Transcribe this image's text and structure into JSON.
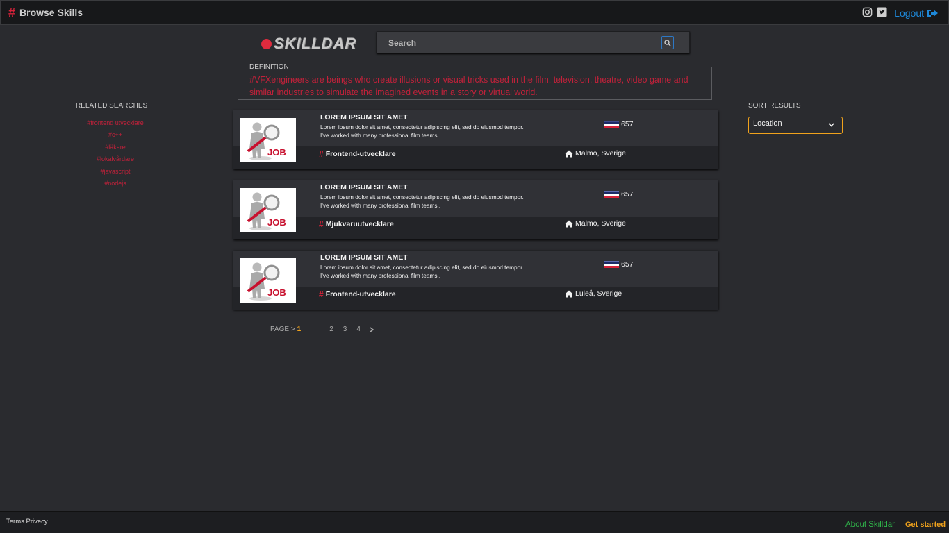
{
  "header": {
    "title": "Browse Skills",
    "logout_label": "Logout"
  },
  "logo": {
    "text": "SKILLDAR"
  },
  "search": {
    "placeholder": "Search"
  },
  "definition": {
    "legend": "DEFINITION",
    "text": "#VFXengineers are beings who create illusions or visual tricks used in the film, television, theatre, video game and similar industries to simulate the imagined events in a story or virtual world."
  },
  "related": {
    "title": "RELATED SEARCHES",
    "items": [
      "#frontend utvecklare",
      "#c++",
      "#läkare",
      "#lokalvårdare",
      "#javascript",
      "#nodejs"
    ]
  },
  "sort": {
    "title": "SORT RESULTS",
    "selected": "Location"
  },
  "cards": [
    {
      "title": "LOREM IPSUM SIT AMET",
      "desc_line1": "Lorem ipsum dolor sit amet, consectetur adipiscing elit, sed do eiusmod tempor.",
      "desc_line2": "I've worked with many professional film teams..",
      "score": "657",
      "skill": "Frontend-utvecklare",
      "location": "Malmö, Sverige",
      "thumb_text": "JOB"
    },
    {
      "title": "LOREM IPSUM SIT AMET",
      "desc_line1": "Lorem ipsum dolor sit amet, consectetur adipiscing elit, sed do eiusmod tempor.",
      "desc_line2": "I've worked with many professional film teams..",
      "score": "657",
      "skill": "Mjukvaruutvecklare",
      "location": "Malmö, Sverige",
      "thumb_text": "JOB"
    },
    {
      "title": "LOREM IPSUM SIT AMET",
      "desc_line1": "Lorem ipsum dolor sit amet, consectetur adipiscing elit, sed do eiusmod tempor.",
      "desc_line2": "I've worked with many professional film teams..",
      "score": "657",
      "skill": "Frontend-utvecklare",
      "location": "Luleå, Sverige",
      "thumb_text": "JOB"
    }
  ],
  "pagination": {
    "label": "PAGE >",
    "current": "1",
    "pages": [
      "2",
      "3",
      "4"
    ]
  },
  "footer": {
    "terms": "Terms Privecy",
    "about": "About Skilldar",
    "get_started": "Get started"
  },
  "colors": {
    "accent_red": "#d6223a",
    "link_blue": "#1e88d8",
    "accent_orange": "#f0a21c",
    "footer_green": "#2fb34a"
  },
  "icons": [
    "hash-icon",
    "instagram-icon",
    "twitter-icon",
    "logout-icon",
    "search-icon",
    "chevron-down-icon",
    "flag-icon",
    "home-icon",
    "chevron-right-icon"
  ]
}
